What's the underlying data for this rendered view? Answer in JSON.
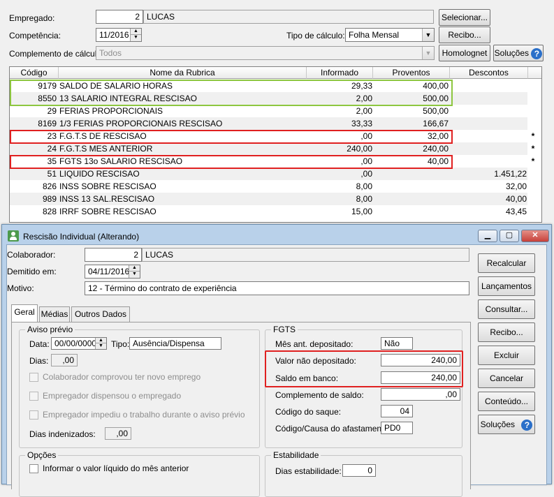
{
  "header": {
    "empregado_label": "Empregado:",
    "empregado_code": "2",
    "empregado_name": "LUCAS",
    "competencia_label": "Competência:",
    "competencia_value": "11/2016",
    "tipo_calculo_label": "Tipo de cálculo:",
    "tipo_calculo_value": "Folha Mensal",
    "complemento_label": "Complemento de cálculo:",
    "complemento_value": "Todos",
    "btn_selecionar": "Selecionar...",
    "btn_recibo": "Recibo...",
    "btn_homolognet": "Homolognet",
    "btn_solucoes": "Soluções"
  },
  "grid": {
    "columns": [
      "Código",
      "Nome da Rubrica",
      "Informado",
      "Proventos",
      "Descontos"
    ],
    "rows": [
      {
        "codigo": "9179",
        "nome": "SALDO DE SALARIO HORAS",
        "informado": "29,33",
        "proventos": "400,00",
        "descontos": "",
        "mark": ""
      },
      {
        "codigo": "8550",
        "nome": "13 SALARIO INTEGRAL RESCISAO",
        "informado": "2,00",
        "proventos": "500,00",
        "descontos": "",
        "mark": ""
      },
      {
        "codigo": "29",
        "nome": "FERIAS PROPORCIONAIS",
        "informado": "2,00",
        "proventos": "500,00",
        "descontos": "",
        "mark": ""
      },
      {
        "codigo": "8169",
        "nome": "1/3 FERIAS PROPORCIONAIS RESCISAO",
        "informado": "33,33",
        "proventos": "166,67",
        "descontos": "",
        "mark": ""
      },
      {
        "codigo": "23",
        "nome": "F.G.T.S DE RESCISAO",
        "informado": ",00",
        "proventos": "32,00",
        "descontos": "",
        "mark": "*"
      },
      {
        "codigo": "24",
        "nome": "F.G.T.S MES ANTERIOR",
        "informado": "240,00",
        "proventos": "240,00",
        "descontos": "",
        "mark": "*"
      },
      {
        "codigo": "35",
        "nome": "FGTS 13o SALARIO RESCISAO",
        "informado": ",00",
        "proventos": "40,00",
        "descontos": "",
        "mark": "*"
      },
      {
        "codigo": "51",
        "nome": "LIQUIDO RESCISAO",
        "informado": ",00",
        "proventos": "",
        "descontos": "1.451,22",
        "mark": ""
      },
      {
        "codigo": "826",
        "nome": "INSS SOBRE RESCISAO",
        "informado": "8,00",
        "proventos": "",
        "descontos": "32,00",
        "mark": ""
      },
      {
        "codigo": "989",
        "nome": "INSS 13 SAL.RESCISAO",
        "informado": "8,00",
        "proventos": "",
        "descontos": "40,00",
        "mark": ""
      },
      {
        "codigo": "828",
        "nome": "IRRF SOBRE RESCISAO",
        "informado": "15,00",
        "proventos": "",
        "descontos": "43,45",
        "mark": ""
      }
    ]
  },
  "dialog": {
    "title": "Rescisão Individual (Alterando)",
    "colaborador_label": "Colaborador:",
    "colaborador_code": "2",
    "colaborador_name": "LUCAS",
    "demitido_label": "Demitido em:",
    "demitido_value": "04/11/2016",
    "motivo_label": "Motivo:",
    "motivo_value": "12 - Término do contrato de experiência",
    "tabs": [
      "Geral",
      "Médias",
      "Outros Dados"
    ],
    "aviso": {
      "title": "Aviso prévio",
      "data_label": "Data:",
      "data_value": "00/00/0000",
      "tipo_label": "Tipo:",
      "tipo_value": "Ausência/Dispensa",
      "dias_label": "Dias:",
      "dias_value": ",00",
      "chk1": "Colaborador comprovou ter novo emprego",
      "chk2": "Empregador dispensou o empregado",
      "chk3": "Empregador impediu o trabalho durante o aviso prévio",
      "dias_indenizados_label": "Dias indenizados:",
      "dias_indenizados_value": ",00"
    },
    "fgts": {
      "title": "FGTS",
      "mes_ant_label": "Mês ant. depositado:",
      "mes_ant_value": "Não",
      "valor_nao_dep_label": "Valor não depositado:",
      "valor_nao_dep_value": "240,00",
      "saldo_banco_label": "Saldo em banco:",
      "saldo_banco_value": "240,00",
      "complemento_label": "Complemento de saldo:",
      "complemento_value": ",00",
      "codigo_saque_label": "Código do saque:",
      "codigo_saque_value": "04",
      "codigo_causa_label": "Código/Causa do afastamento:",
      "codigo_causa_value": "PD0"
    },
    "opcoes": {
      "title": "Opções",
      "chk1": "Informar o valor líquido do mês anterior"
    },
    "estabilidade": {
      "title": "Estabilidade",
      "dias_label": "Dias estabilidade:",
      "dias_value": "0"
    },
    "buttons": {
      "recalcular": "Recalcular",
      "lancamentos": "Lançamentos",
      "consultar": "Consultar...",
      "recibo": "Recibo...",
      "excluir": "Excluir",
      "cancelar": "Cancelar",
      "conteudo": "Conteúdo...",
      "solucoes": "Soluções"
    }
  },
  "colors": {
    "highlight_green": "#8dc63f",
    "highlight_red": "#e02020",
    "window_frame": "#b9d1ea",
    "close_button": "#c7413a"
  }
}
